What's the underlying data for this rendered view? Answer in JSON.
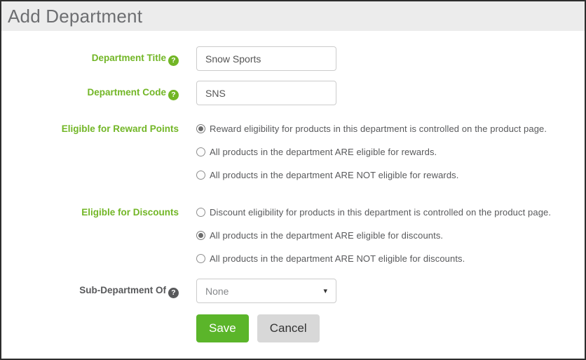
{
  "header": {
    "title": "Add Department"
  },
  "icons": {
    "help": "?",
    "caret_down": "▾"
  },
  "colors": {
    "label_green": "#72b626",
    "label_dark": "#58595b",
    "save_green": "#5bb52a",
    "cancel_gray": "#d8d8d8",
    "header_bg": "#ececec",
    "input_border": "#cccccc"
  },
  "form": {
    "title_field": {
      "label": "Department Title",
      "value": "Snow Sports"
    },
    "code_field": {
      "label": "Department Code",
      "value": "SNS"
    },
    "rewards": {
      "label": "Eligible for Reward Points",
      "options": [
        {
          "text": "Reward eligibility for products in this department is controlled on the product page.",
          "selected": true
        },
        {
          "text": "All products in the department ARE eligible for rewards.",
          "selected": false
        },
        {
          "text": "All products in the department ARE NOT eligible for rewards.",
          "selected": false
        }
      ]
    },
    "discounts": {
      "label": "Eligible for Discounts",
      "options": [
        {
          "text": "Discount eligibility for products in this department is controlled on the product page.",
          "selected": false
        },
        {
          "text": "All products in the department ARE eligible for discounts.",
          "selected": true
        },
        {
          "text": "All products in the department ARE NOT eligible for discounts.",
          "selected": false
        }
      ]
    },
    "sub_department": {
      "label": "Sub-Department Of",
      "value": "None"
    },
    "buttons": {
      "save": "Save",
      "cancel": "Cancel"
    }
  }
}
